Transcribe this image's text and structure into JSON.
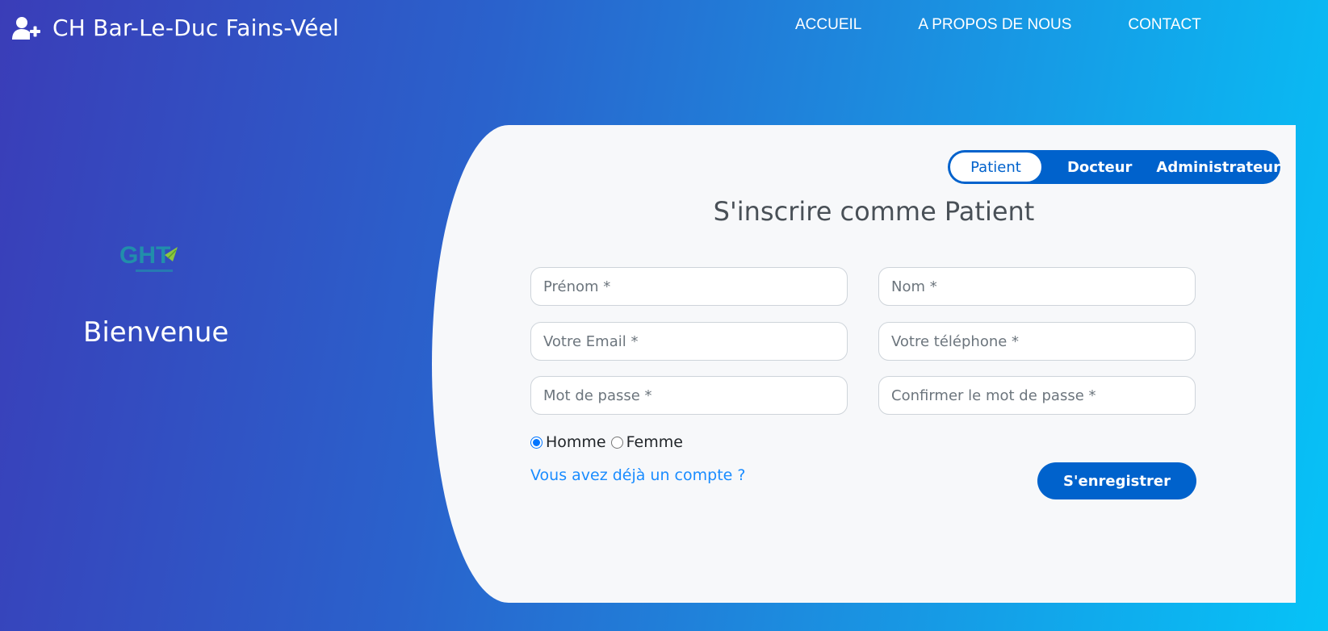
{
  "header": {
    "brand_icon": "user-plus-icon",
    "brand_title": "CH Bar-Le-Duc Fains-Véel",
    "nav": [
      {
        "label": "ACCUEIL"
      },
      {
        "label": "A PROPOS DE NOUS"
      },
      {
        "label": "CONTACT"
      }
    ]
  },
  "left": {
    "logo_text": "GHT",
    "welcome": "Bienvenue"
  },
  "form": {
    "role_tabs": [
      {
        "label": "Patient",
        "active": true
      },
      {
        "label": "Docteur",
        "active": false
      },
      {
        "label": "Administrateur",
        "active": false
      }
    ],
    "title": "S'inscrire comme Patient",
    "fields": {
      "prenom": {
        "placeholder": "Prénom *",
        "value": ""
      },
      "nom": {
        "placeholder": "Nom *",
        "value": ""
      },
      "email": {
        "placeholder": "Votre Email *",
        "value": ""
      },
      "telephone": {
        "placeholder": "Votre téléphone *",
        "value": ""
      },
      "password": {
        "placeholder": "Mot de passe *",
        "value": ""
      },
      "confirm_password": {
        "placeholder": "Confirmer le mot de passe *",
        "value": ""
      }
    },
    "gender": {
      "options": [
        "Homme",
        "Femme"
      ],
      "selected": "Homme"
    },
    "login_link": "Vous avez déjà un compte ?",
    "submit_label": "S'enregistrer"
  },
  "colors": {
    "gradient_start": "#3a3db8",
    "gradient_end": "#06c3f7",
    "primary": "#0062cc",
    "link": "#1a8cff",
    "card_bg": "#f7f8fa"
  }
}
